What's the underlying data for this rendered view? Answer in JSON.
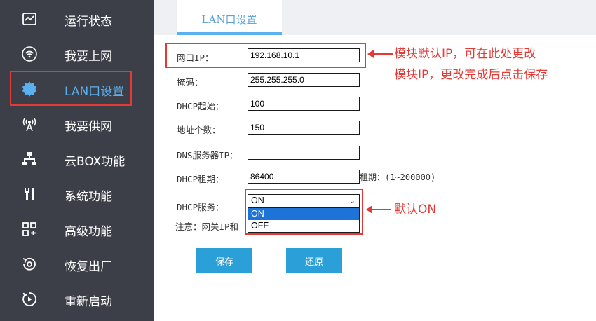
{
  "sidebar": {
    "items": [
      {
        "label": "运行状态",
        "icon": "monitor-chart-icon"
      },
      {
        "label": "我要上网",
        "icon": "wifi-icon"
      },
      {
        "label": "LAN口设置",
        "icon": "gear-icon",
        "active": true
      },
      {
        "label": "我要供网",
        "icon": "broadcast-antenna-icon"
      },
      {
        "label": "云BOX功能",
        "icon": "network-tree-icon"
      },
      {
        "label": "系统功能",
        "icon": "tools-icon"
      },
      {
        "label": "高级功能",
        "icon": "grid-plus-icon"
      },
      {
        "label": "恢复出厂",
        "icon": "restore-icon"
      },
      {
        "label": "重新启动",
        "icon": "restart-icon"
      }
    ]
  },
  "tab": {
    "label": "LAN口设置"
  },
  "form": {
    "ip": {
      "label": "网口IP：",
      "value": "192.168.10.1"
    },
    "mask": {
      "label": "掩码：",
      "value": "255.255.255.0"
    },
    "dhcp_start": {
      "label": "DHCP起始：",
      "value": "100"
    },
    "count": {
      "label": "地址个数：",
      "value": "150"
    },
    "dns": {
      "label": "DNS服务器IP：",
      "value": ""
    },
    "lease": {
      "label": "DHCP租期：",
      "value": "86400",
      "hint": "租期：(1~200000)"
    },
    "dhcp_service": {
      "label": "DHCP服务：",
      "selected": "ON",
      "options": [
        "ON",
        "OFF"
      ]
    },
    "note": "注意：网关IP和"
  },
  "buttons": {
    "save": "保存",
    "restore": "还原"
  },
  "annotations": {
    "ip_note_line1": "模块默认IP，可在此处更改",
    "ip_note_line2": "模块IP，更改完成后点击保存",
    "dhcp_note": "默认ON"
  },
  "colors": {
    "sidebar_bg": "#3d3f48",
    "accent": "#5bb0f0",
    "button": "#2a9fd8",
    "annotation": "#e53935"
  }
}
